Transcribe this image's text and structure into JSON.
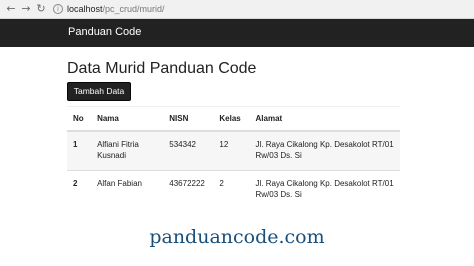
{
  "browser": {
    "url_host": "localhost",
    "url_path": "/pc_crud/murid/"
  },
  "navbar": {
    "brand": "Panduan Code"
  },
  "main": {
    "title": "Data Murid Panduan Code",
    "add_button": "Tambah Data",
    "table": {
      "headers": [
        "No",
        "Nama",
        "NISN",
        "Kelas",
        "Alamat"
      ],
      "rows": [
        {
          "no": "1",
          "nama": "Alfiani Fitria Kusnadi",
          "nisn": "534342",
          "kelas": "12",
          "alamat": "Jl. Raya Cikalong Kp. Desakolot RT/01 Rw/03 Ds. Si"
        },
        {
          "no": "2",
          "nama": "Alfan Fabian",
          "nisn": "43672222",
          "kelas": "2",
          "alamat": "Jl. Raya Cikalong Kp. Desakolot RT/01 Rw/03 Ds. Si"
        }
      ]
    }
  },
  "watermark": "panduancode.com"
}
